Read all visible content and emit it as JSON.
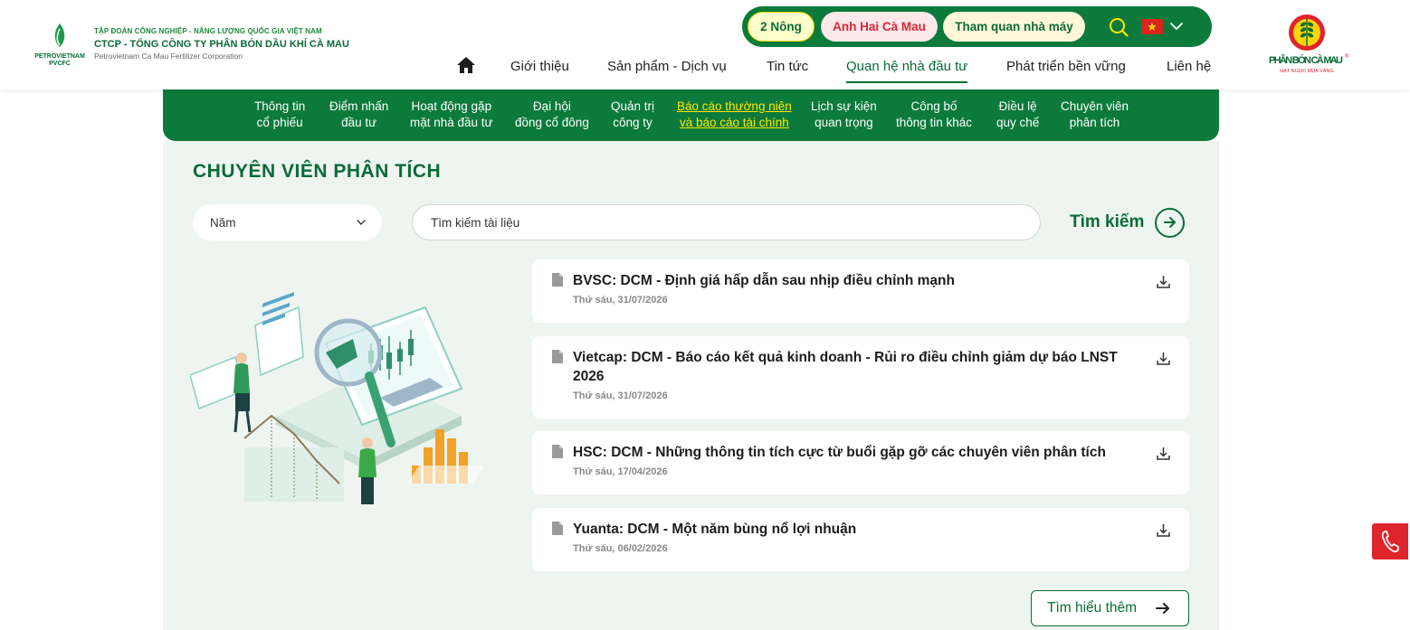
{
  "corp": {
    "line1": "TẬP ĐOÀN CÔNG NGHIỆP - NĂNG LƯỢNG QUỐC GIA VIỆT NAM",
    "line2": "CTCP - TỔNG CÔNG TY PHÂN BÓN DẦU KHÍ CÀ MAU",
    "line3": "Petrovietnam Ca Mau Fertilizer Corporation",
    "logo_text1": "PETROVIETNAM",
    "logo_text2": "PVCFC"
  },
  "pills": [
    "2 Nông",
    "Anh Hai Cà Mau",
    "Tham quan nhà máy"
  ],
  "flag_star": "★",
  "nav": [
    "Giới thiệu",
    "Sản phẩm - Dịch vụ",
    "Tin tức",
    "Quan hệ nhà đầu tư",
    "Phát triển bền vững",
    "Liên hệ"
  ],
  "brand": {
    "name": "PHÂN BÓN CÀ MAU",
    "registered": "®",
    "tagline": "HẠT NGỌC MÙA VÀNG"
  },
  "subnav": [
    [
      "Thông tin",
      "cổ phiếu"
    ],
    [
      "Điểm nhấn",
      "đầu tư"
    ],
    [
      "Hoạt động gặp",
      "mặt nhà đầu tư"
    ],
    [
      "Đại hội",
      "đồng cổ đông"
    ],
    [
      "Quản trị",
      "công ty"
    ],
    [
      "Báo cáo thường niên",
      "và báo cáo tài chính"
    ],
    [
      "Lịch sự kiện",
      "quan trọng"
    ],
    [
      "Công bố",
      "thông tin khác"
    ],
    [
      "Điều lệ",
      "quy chế"
    ],
    [
      "Chuyên viên",
      "phân tích"
    ]
  ],
  "page": {
    "title": "CHUYÊN VIÊN PHÂN TÍCH",
    "year_label": "Năm",
    "search_placeholder": "Tìm kiếm tài liệu",
    "search_button": "Tìm kiếm",
    "more_button": "Tìm hiểu thêm"
  },
  "reports": [
    {
      "title": "BVSC: DCM - Định giá hấp dẫn sau nhịp điều chỉnh mạnh",
      "date": "Thứ sáu, 31/07/2026"
    },
    {
      "title": "Vietcap: DCM - Báo cáo kết quả kinh doanh - Rủi ro điều chỉnh giảm dự báo LNST 2026",
      "date": "Thứ sáu, 31/07/2026"
    },
    {
      "title": "HSC: DCM - Những thông tin tích cực từ buổi gặp gỡ các chuyên viên phân tích",
      "date": "Thứ sáu, 17/04/2026"
    },
    {
      "title": "Yuanta: DCM - Một năm bùng nổ lợi nhuận",
      "date": "Thứ sáu, 06/02/2026"
    }
  ],
  "colors": {
    "primary_green": "#0b7a3a",
    "dark_green": "#0b6b36",
    "active_subnav": "#ffe600",
    "accent_red": "#e0242b"
  }
}
